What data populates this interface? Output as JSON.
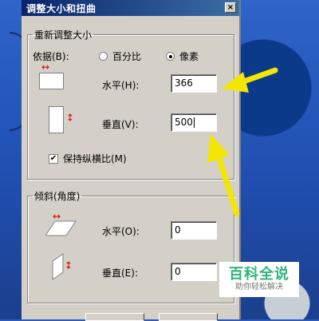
{
  "window": {
    "title": "调整大小和扭曲",
    "close_glyph": "×"
  },
  "resize": {
    "legend": "重新调整大小",
    "by_label": "依据(B):",
    "options": [
      {
        "label": "百分比",
        "selected": false
      },
      {
        "label": "像素",
        "selected": true
      }
    ],
    "horizontal_label": "水平(H):",
    "horizontal_value": "366",
    "vertical_label": "垂直(V):",
    "vertical_value": "500",
    "keep_ratio_label": "保持纵横比(M)",
    "keep_ratio_checked": true
  },
  "skew": {
    "legend": "倾斜(角度)",
    "horizontal_label": "水平(O):",
    "horizontal_value": "0",
    "vertical_label": "垂直(E):",
    "vertical_value": "0"
  },
  "watermark": {
    "main": "百科全说",
    "sub": "助你轻松解决"
  },
  "colors": {
    "titlebar": "#0a246a",
    "dialog": "#d4d0c8",
    "arrow": "#f3e600",
    "brand": "#2fb57a"
  }
}
